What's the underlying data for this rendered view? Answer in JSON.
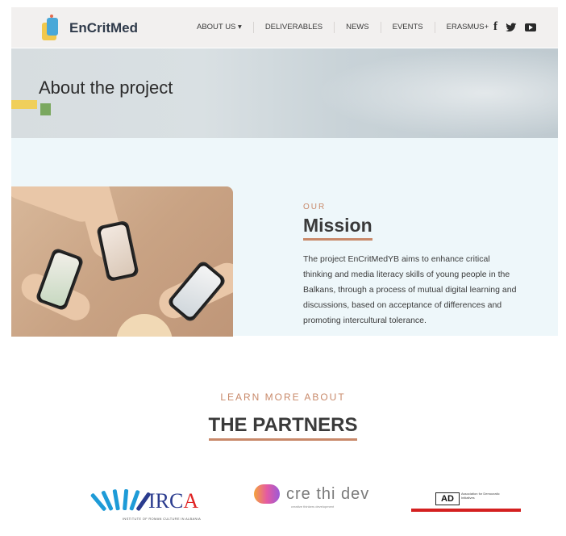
{
  "header": {
    "logo_text": "EnCritMed",
    "nav": [
      {
        "label": "ABOUT US ▾"
      },
      {
        "label": "DELIVERABLES"
      },
      {
        "label": "NEWS"
      },
      {
        "label": "EVENTS"
      },
      {
        "label": "ERASMUS+"
      }
    ],
    "social": {
      "facebook": "f",
      "twitter": "🐦"
    }
  },
  "hero": {
    "title": "About the project"
  },
  "mission": {
    "kicker": "OUR",
    "title": "Mission",
    "body": "The project EnCritMedYB aims to enhance critical thinking and media literacy skills of young people in the Balkans, through a process of mutual digital learning and discussions, based on acceptance of differences and promoting intercultural tolerance."
  },
  "partners": {
    "kicker": "LEARN MORE ABOUT",
    "title": "THE PARTNERS",
    "irca": {
      "name_main": "IRC",
      "name_accent": "A",
      "subtitle": "INSTITUTE OF ROMAN CULTURE IN ALBANIA"
    },
    "ctd": {
      "name": "cre thi dev",
      "subtitle": "creative thinkers development"
    },
    "ad": {
      "abbr": "AD",
      "desc": "Association for Democratic Initiatives"
    }
  },
  "colors": {
    "accent": "#c8896a",
    "mission_bg": "#eef7fa",
    "header_bg": "#f2f0ef"
  }
}
